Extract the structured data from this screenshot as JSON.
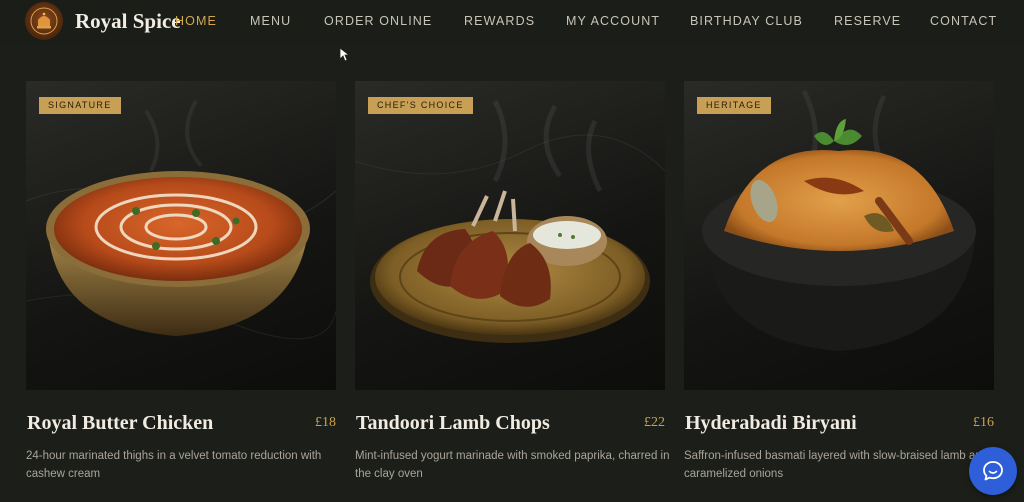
{
  "brand": {
    "name": "Royal Spice"
  },
  "nav": {
    "items": [
      {
        "label": "HOME"
      },
      {
        "label": "MENU"
      },
      {
        "label": "ORDER ONLINE"
      },
      {
        "label": "REWARDS"
      },
      {
        "label": "MY ACCOUNT"
      },
      {
        "label": "BIRTHDAY CLUB"
      },
      {
        "label": "RESERVE"
      },
      {
        "label": "CONTACT"
      }
    ],
    "active": "HOME"
  },
  "dishes": [
    {
      "badge": "SIGNATURE",
      "name": "Royal Butter Chicken",
      "price": "£18",
      "description": "24-hour marinated thighs in a velvet tomato reduction with cashew cream"
    },
    {
      "badge": "CHEF'S CHOICE",
      "name": "Tandoori Lamb Chops",
      "price": "£22",
      "description": "Mint-infused yogurt marinade with smoked paprika, charred in the clay oven"
    },
    {
      "badge": "HERITAGE",
      "name": "Hyderabadi Biryani",
      "price": "£16",
      "description": "Saffron-infused basmati layered with slow-braised lamb and caramelized onions"
    }
  ],
  "colors": {
    "background": "#1c1f19",
    "accent_gold": "#c9a052",
    "chat_blue": "#2e5fd9"
  },
  "icons": {
    "logo": "palace-emblem-icon",
    "chat": "chat-bubble-icon",
    "cursor": "mouse-pointer-icon"
  }
}
